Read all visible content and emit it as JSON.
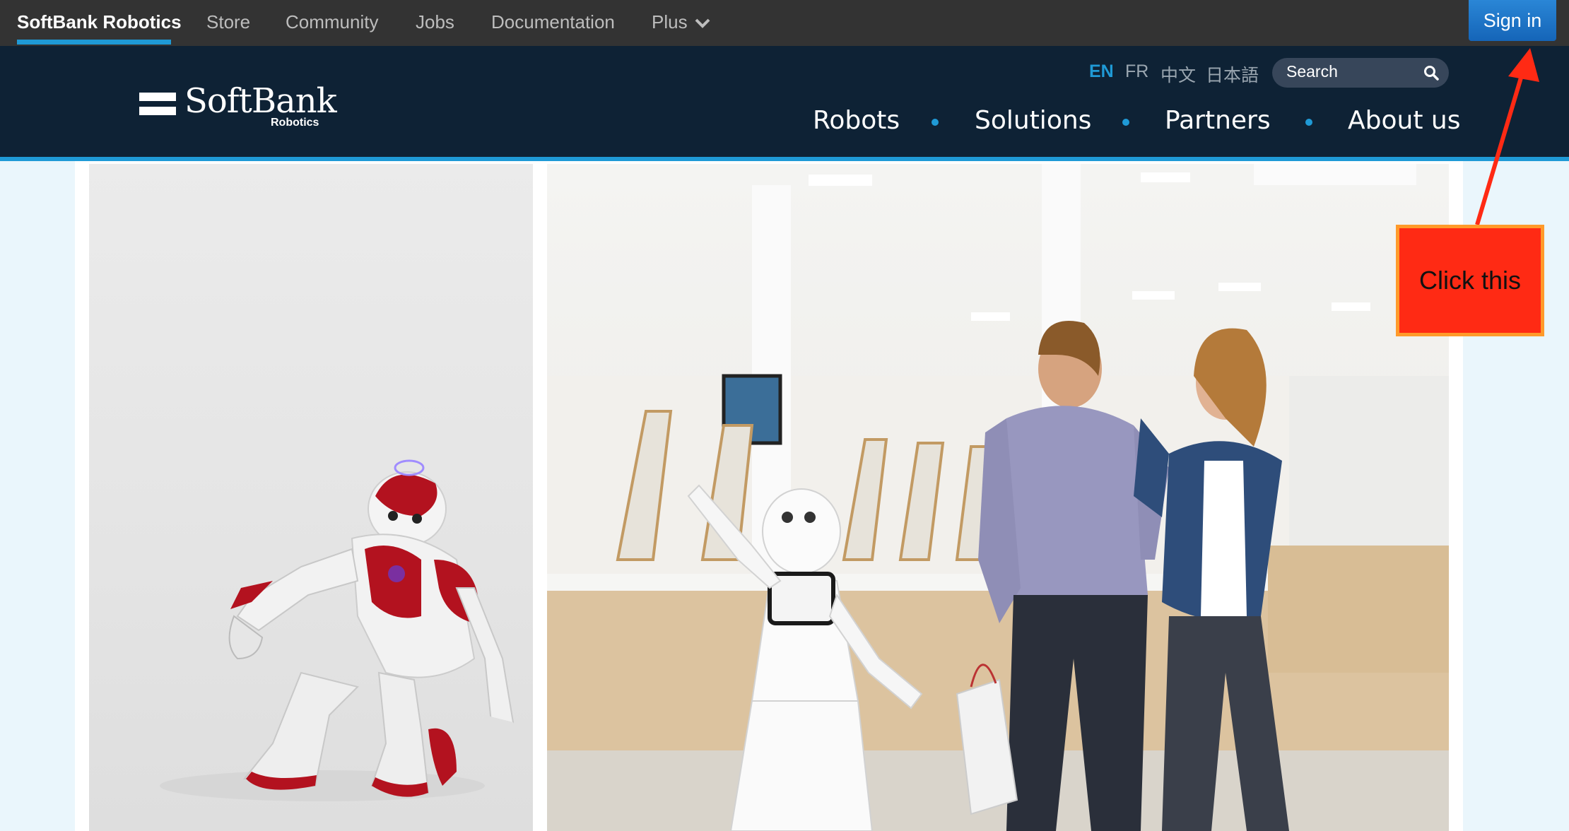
{
  "topbar": {
    "brand": "SoftBank Robotics",
    "links": [
      "Store",
      "Community",
      "Jobs",
      "Documentation",
      "Plus"
    ],
    "sign_in": "Sign in"
  },
  "header": {
    "logo_word": "SoftBank",
    "logo_sub": "Robotics",
    "languages": [
      "EN",
      "FR",
      "中文",
      "日本語"
    ],
    "active_language": "EN",
    "search_placeholder": "Search",
    "nav": [
      "Robots",
      "Solutions",
      "Partners",
      "About us"
    ]
  },
  "annotation": {
    "label": "Click this"
  },
  "colors": {
    "topbar": "#333333",
    "header": "#0e2235",
    "accent": "#1f9ad6",
    "signin": "#1e73c8",
    "callout": "#ff2a14",
    "callout_border": "#ff9a2a",
    "arrow": "#ff2a14"
  }
}
